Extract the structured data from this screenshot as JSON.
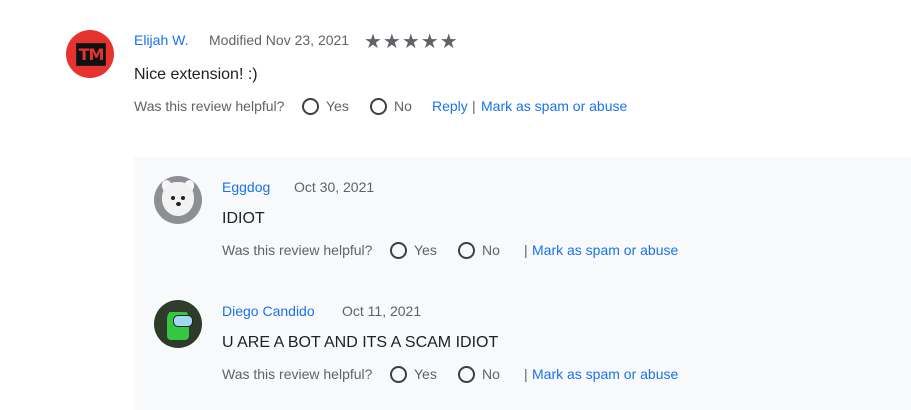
{
  "review": {
    "author": "Elijah W.",
    "date": "Modified Nov 23, 2021",
    "rating": 5,
    "stars": "★★★★★",
    "body": "Nice extension! :)",
    "avatar_text": "TM",
    "helpful": {
      "question": "Was this review helpful?",
      "yes": "Yes",
      "no": "No",
      "reply": "Reply",
      "separator": "|",
      "spam": "Mark as spam or abuse"
    }
  },
  "replies": [
    {
      "author": "Eggdog",
      "date": "Oct 30, 2021",
      "body": "IDIOT",
      "helpful": {
        "question": "Was this review helpful?",
        "yes": "Yes",
        "no": "No",
        "separator": "|",
        "spam": "Mark as spam or abuse"
      }
    },
    {
      "author": "Diego Candido",
      "date": "Oct 11, 2021",
      "body": "U ARE A BOT AND ITS A SCAM IDIOT",
      "helpful": {
        "question": "Was this review helpful?",
        "yes": "Yes",
        "no": "No",
        "separator": "|",
        "spam": "Mark as spam or abuse"
      }
    }
  ],
  "colors": {
    "link": "#1a73e8",
    "muted": "#5f6368",
    "reply_bg": "#f8f9fa",
    "avatar_red": "#e8322d"
  }
}
